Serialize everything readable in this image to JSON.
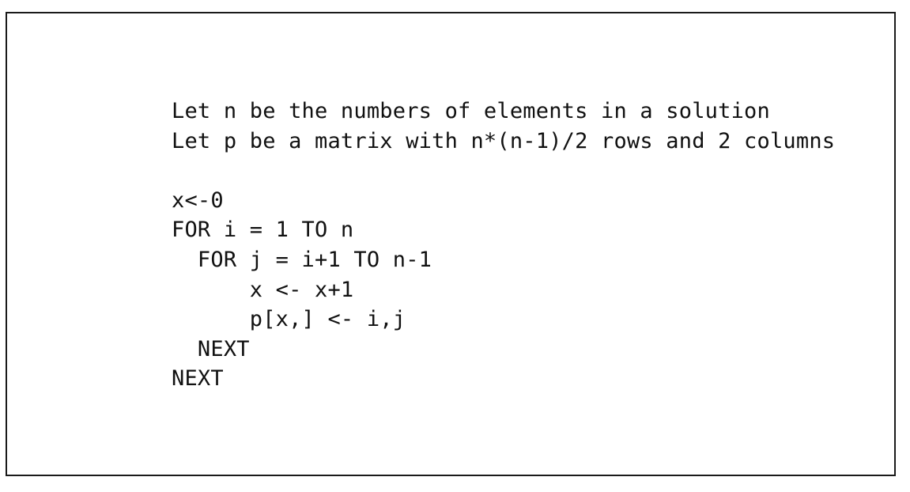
{
  "document": {
    "lines": [
      "Let n be the numbers of elements in a solution",
      "Let p be a matrix with n*(n-1)/2 rows and 2 columns",
      "",
      "x<-0",
      "FOR i = 1 TO n",
      "  FOR j = i+1 TO n-1",
      "      x <- x+1",
      "      p[x,] <- i,j",
      "  NEXT",
      "NEXT"
    ]
  }
}
